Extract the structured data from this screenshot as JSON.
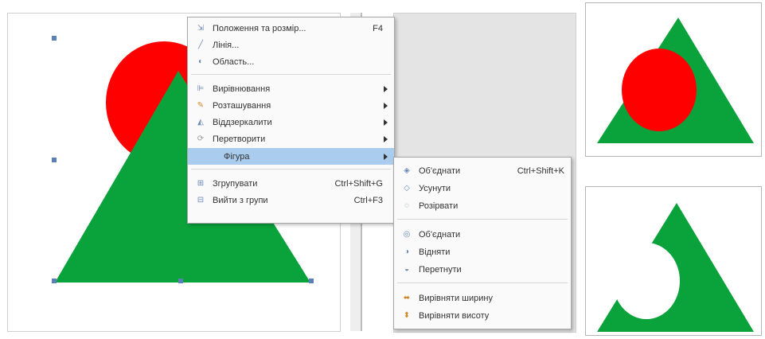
{
  "context_menu": {
    "items": [
      {
        "label": "Положення та розмір...",
        "shortcut": "F4",
        "icon": "position-size-icon"
      },
      {
        "label": "Лінія...",
        "icon": "line-icon"
      },
      {
        "label": "Область...",
        "icon": "area-icon"
      },
      {
        "label": "Вирівнювання",
        "icon": "align-icon"
      },
      {
        "label": "Розташування",
        "icon": "arrange-icon"
      },
      {
        "label": "Віддзеркалити",
        "icon": "flip-icon"
      },
      {
        "label": "Перетворити",
        "icon": "convert-icon"
      },
      {
        "label": "Фігура",
        "icon": "shape-icon"
      },
      {
        "label": "Згрупувати",
        "shortcut": "Ctrl+Shift+G",
        "icon": "group-icon"
      },
      {
        "label": "Вийти з групи",
        "shortcut": "Ctrl+F3",
        "icon": "exit-group-icon"
      }
    ]
  },
  "submenu": {
    "items": [
      {
        "label": "Об'єднати",
        "shortcut": "Ctrl+Shift+K",
        "icon": "combine-icon"
      },
      {
        "label": "Усунути",
        "icon": "split-icon"
      },
      {
        "label": "Розірвати",
        "icon": "break-icon"
      },
      {
        "label": "Об'єднати",
        "icon": "merge-icon"
      },
      {
        "label": "Відняти",
        "icon": "subtract-icon"
      },
      {
        "label": "Перетнути",
        "icon": "intersect-icon"
      },
      {
        "label": "Вирівняти ширину",
        "icon": "equalize-width-icon"
      },
      {
        "label": "Вирівняти висоту",
        "icon": "equalize-height-icon"
      }
    ]
  },
  "colors": {
    "triangle": "#0aa23b",
    "circle": "#ff0000",
    "selection": "#aaccee"
  }
}
